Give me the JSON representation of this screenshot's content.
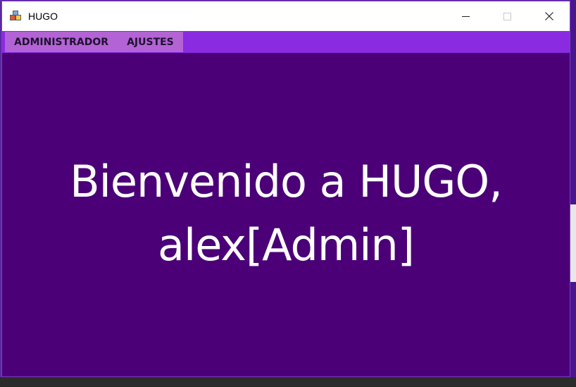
{
  "window": {
    "title": "HUGO"
  },
  "menu": {
    "items": [
      {
        "label": "ADMINISTRADOR"
      },
      {
        "label": "AJUSTES"
      }
    ]
  },
  "main": {
    "welcome_line1": "Bienvenido a HUGO,",
    "welcome_line2": "alex[Admin]"
  },
  "colors": {
    "menubar": "#8a2be2",
    "menu_highlight": "#b463d6",
    "content_bg": "#4b0077",
    "text": "#ffffff"
  }
}
